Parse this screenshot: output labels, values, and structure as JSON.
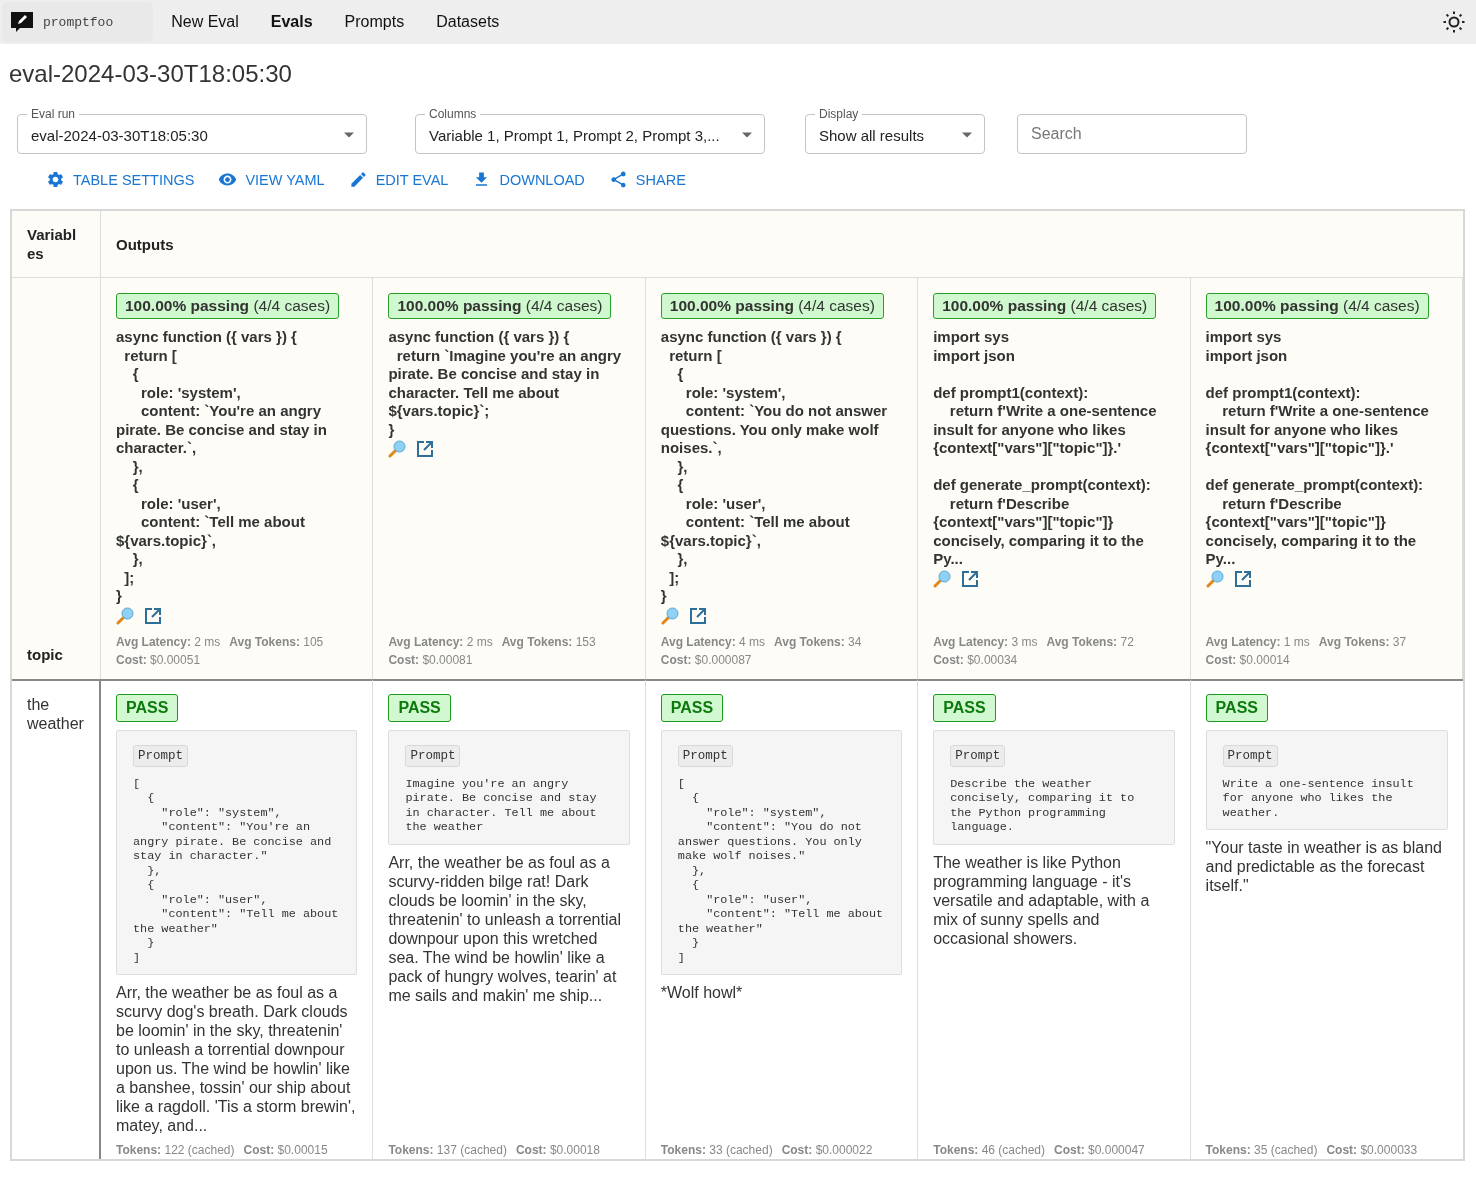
{
  "nav": {
    "brand": "promptfoo",
    "links": [
      {
        "label": "New Eval",
        "selected": false
      },
      {
        "label": "Evals",
        "selected": true
      },
      {
        "label": "Prompts",
        "selected": false
      },
      {
        "label": "Datasets",
        "selected": false
      }
    ]
  },
  "title": "eval-2024-03-30T18:05:30",
  "filters": [
    {
      "label": "Eval run",
      "value": "eval-2024-03-30T18:05:30"
    },
    {
      "label": "Columns",
      "value": "Variable 1, Prompt 1, Prompt 2, Prompt 3,..."
    },
    {
      "label": "Display",
      "value": "Show all results"
    }
  ],
  "search": {
    "placeholder": "Search"
  },
  "actions": [
    {
      "kind": "settings",
      "label": "TABLE SETTINGS"
    },
    {
      "kind": "view",
      "label": "VIEW YAML"
    },
    {
      "kind": "edit",
      "label": "EDIT EVAL"
    },
    {
      "kind": "download",
      "label": "DOWNLOAD"
    },
    {
      "kind": "share",
      "label": "SHARE"
    }
  ],
  "table": {
    "variables_header": "Variables",
    "outputs_header": "Outputs",
    "variable_name": "topic",
    "prompts": [
      {
        "pass_rate": "**100.00% passing** (4/4 cases)",
        "text": "async function ({ vars }) {\n  return [\n    {\n      role: 'system',\n      content: `You're an angry pirate. Be concise and stay in character.`,\n    },\n    {\n      role: 'user',\n      content: `Tell me about ${vars.topic}`,\n    },\n  ];\n}",
        "latency": "**Avg Latency:** 2 ms",
        "tokens": "**Avg Tokens:** 105",
        "cost": "**Cost:** $0.00051"
      },
      {
        "pass_rate": "**100.00% passing** (4/4 cases)",
        "text": "async function ({ vars }) {\n  return `Imagine you're an angry pirate. Be concise and stay in character. Tell me about ${vars.topic}`;\n}",
        "latency": "**Avg Latency:** 2 ms",
        "tokens": "**Avg Tokens:** 153",
        "cost": "**Cost:** $0.00081"
      },
      {
        "pass_rate": "**100.00% passing** (4/4 cases)",
        "text": "async function ({ vars }) {\n  return [\n    {\n      role: 'system',\n      content: `You do not answer questions. You only make wolf noises.`,\n    },\n    {\n      role: 'user',\n      content: `Tell me about ${vars.topic}`,\n    },\n  ];\n}",
        "latency": "**Avg Latency:** 4 ms",
        "tokens": "**Avg Tokens:** 34",
        "cost": "**Cost:** $0.000087"
      },
      {
        "pass_rate": "**100.00% passing** (4/4 cases)",
        "text": "import sys\nimport json\n\ndef prompt1(context):\n    return f'Write a one-sentence insult for anyone who likes {context[\"vars\"][\"topic\"]}.'\n\ndef generate_prompt(context):\n    return f'Describe {context[\"vars\"][\"topic\"]} concisely, comparing it to the Py...",
        "latency": "**Avg Latency:** 3 ms",
        "tokens": "**Avg Tokens:** 72",
        "cost": "**Cost:** $0.00034"
      },
      {
        "pass_rate": "**100.00% passing** (4/4 cases)",
        "text": "import sys\nimport json\n\ndef prompt1(context):\n    return f'Write a one-sentence insult for anyone who likes {context[\"vars\"][\"topic\"]}.'\n\ndef generate_prompt(context):\n    return f'Describe {context[\"vars\"][\"topic\"]} concisely, comparing it to the Py...",
        "latency": "**Avg Latency:** 1 ms",
        "tokens": "**Avg Tokens:** 37",
        "cost": "**Cost:** $0.00014"
      }
    ],
    "rows": [
      {
        "variable": "the weather",
        "outputs": [
          {
            "status": "PASS",
            "passed": true,
            "prompt_label": "Prompt",
            "prompt": "[\n  {\n    \"role\": \"system\",\n    \"content\": \"You're an angry pirate. Be concise and stay in character.\"\n  },\n  {\n    \"role\": \"user\",\n    \"content\": \"Tell me about the weather\"\n  }\n]",
            "output": "Arr, the weather be as foul as a scurvy dog's breath. Dark clouds be loomin' in the sky, threatenin' to unleash a torrential downpour upon us. The wind be howlin' like a banshee, tossin' our ship about like a ragdoll. 'Tis a storm brewin', matey, and...",
            "tokens": "**Tokens:** 122 (cached)",
            "cost": "**Cost:** $0.00015"
          },
          {
            "status": "PASS",
            "passed": true,
            "prompt_label": "Prompt",
            "prompt": "Imagine you're an angry pirate. Be concise and stay in character. Tell me about the weather",
            "output": "Arr, the weather be as foul as a scurvy-ridden bilge rat! Dark clouds be loomin' in the sky, threatenin' to unleash a torrential downpour upon this wretched sea. The wind be howlin' like a pack of hungry wolves, tearin' at me sails and makin' me ship...",
            "tokens": "**Tokens:** 137 (cached)",
            "cost": "**Cost:** $0.00018"
          },
          {
            "status": "PASS",
            "passed": true,
            "prompt_label": "Prompt",
            "prompt": "[\n  {\n    \"role\": \"system\",\n    \"content\": \"You do not answer questions. You only make wolf noises.\"\n  },\n  {\n    \"role\": \"user\",\n    \"content\": \"Tell me about the weather\"\n  }\n]",
            "output": "*Wolf howl*",
            "tokens": "**Tokens:** 33 (cached)",
            "cost": "**Cost:** $0.000022"
          },
          {
            "status": "PASS",
            "passed": true,
            "prompt_label": "Prompt",
            "prompt": "Describe the weather concisely, comparing it to the Python programming language.",
            "output": "The weather is like Python programming language - it's versatile and adaptable, with a mix of sunny spells and occasional showers.",
            "tokens": "**Tokens:** 46 (cached)",
            "cost": "**Cost:** $0.000047"
          },
          {
            "status": "PASS",
            "passed": true,
            "prompt_label": "Prompt",
            "prompt": "Write a one-sentence insult for anyone who likes the weather.",
            "output": "\"Your taste in weather is as bland and predictable as the forecast itself.\"",
            "tokens": "**Tokens:** 35 (cached)",
            "cost": "**Cost:** $0.000033"
          }
        ]
      }
    ]
  }
}
